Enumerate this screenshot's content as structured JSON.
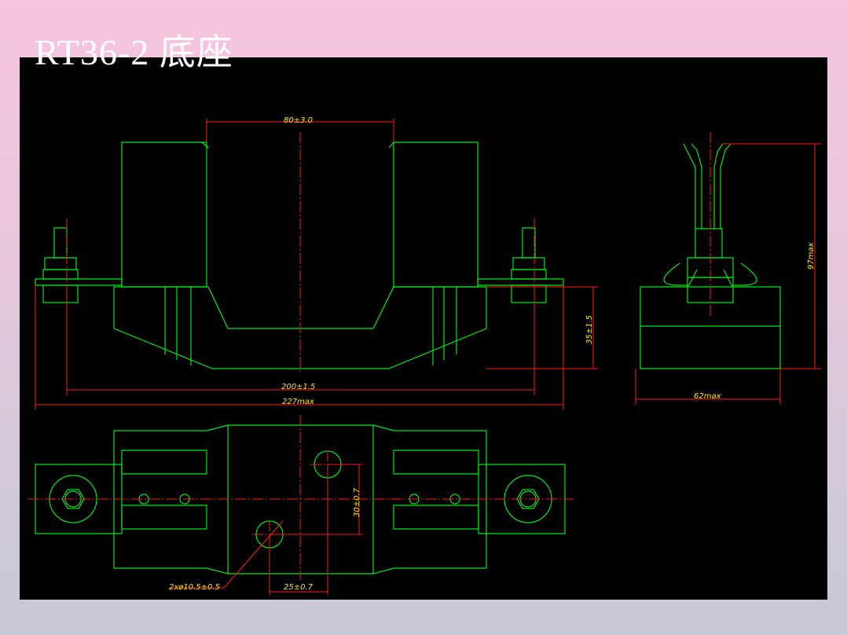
{
  "slide": {
    "title": "RT36-2 底座"
  },
  "dimensions": {
    "width_top": "80±3.0",
    "height_base": "35±1.5",
    "mounting_span": "200±1.5",
    "overall_width": "227max",
    "side_height": "97max",
    "side_width": "62max",
    "hole_offset_v": "30±0.7",
    "hole_spec": "2xø10.5±0.5",
    "hole_offset_h": "25±0.7"
  },
  "colors": {
    "background": "#000000",
    "outline": "#00e61a",
    "dimension": "#ff1a1a",
    "text": "#ffe600"
  }
}
